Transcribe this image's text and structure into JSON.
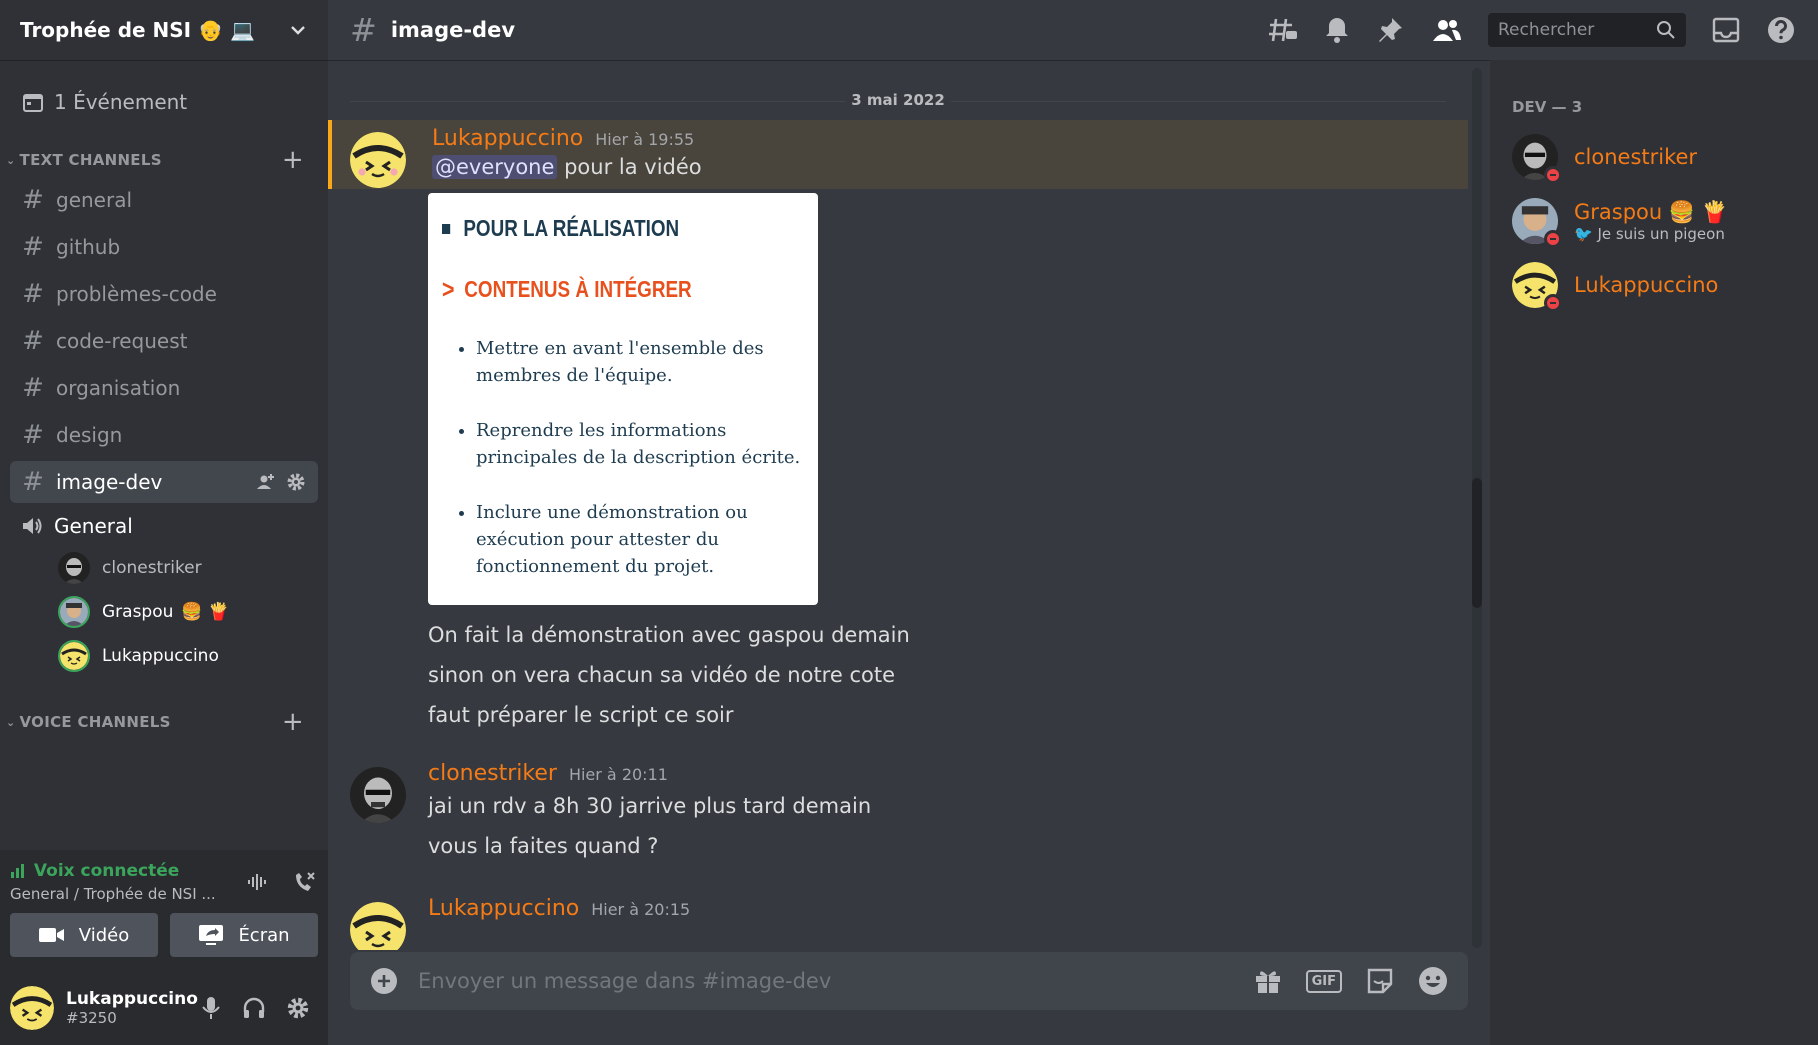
{
  "server": {
    "name": "Trophée de NSI 👴 💻"
  },
  "sidebar": {
    "events_label": "1 Événement",
    "text_category": "TEXT CHANNELS",
    "voice_category": "VOICE CHANNELS",
    "channels": [
      "general",
      "github",
      "problèmes-code",
      "code-request",
      "organisation",
      "design",
      "image-dev"
    ],
    "active_channel": "image-dev",
    "voice_channel": "General",
    "voice_users": [
      {
        "name": "clonestriker",
        "emoji": ""
      },
      {
        "name": "Graspou",
        "emoji": "🍔 🍟"
      },
      {
        "name": "Lukappuccino",
        "emoji": ""
      }
    ]
  },
  "voice_panel": {
    "status": "Voix connectée",
    "location": "General / Trophée de NSI ...",
    "video_label": "Vidéo",
    "screen_label": "Écran"
  },
  "user_panel": {
    "username": "Lukappuccino",
    "tag": "#3250"
  },
  "header": {
    "channel": "image-dev",
    "search_placeholder": "Rechercher"
  },
  "messages": {
    "date_divider": "3 mai 2022",
    "items": [
      {
        "author": "Lukappuccino",
        "time": "Hier à 19:55",
        "mention": "@everyone",
        "first_line": " pour la vidéo",
        "attachment": {
          "heading1": "POUR LA RÉALISATION",
          "heading2": "CONTENUS À INTÉGRER",
          "bullets": [
            "Mettre en avant l'ensemble des membres de l'équipe.",
            "Reprendre les informations principales de la description écrite.",
            "Inclure une démonstration ou exécution pour attester du fonctionnement du projet."
          ]
        },
        "lines": [
          "On fait la démonstration avec gaspou demain",
          "sinon on vera chacun sa vidéo de notre cote",
          "faut préparer le script ce soir"
        ]
      },
      {
        "author": "clonestriker",
        "time": "Hier à 20:11",
        "lines": [
          "jai un rdv a 8h 30 jarrive plus tard demain",
          "vous la faites quand ?"
        ]
      },
      {
        "author": "Lukappuccino",
        "time": "Hier à 20:15"
      }
    ]
  },
  "composer": {
    "placeholder": "Envoyer un message dans #image-dev",
    "gif_label": "GIF"
  },
  "members": {
    "group_label": "DEV — 3",
    "list": [
      {
        "name": "clonestriker",
        "status": ""
      },
      {
        "name": "Graspou 🍔 🍟",
        "status": "🐦 Je suis un pigeon"
      },
      {
        "name": "Lukappuccino",
        "status": ""
      }
    ]
  },
  "colors": {
    "accent": "#f47b16",
    "voice_green": "#3ba55c",
    "dnd": "#ed4245",
    "mention_bg": "#49443c"
  }
}
